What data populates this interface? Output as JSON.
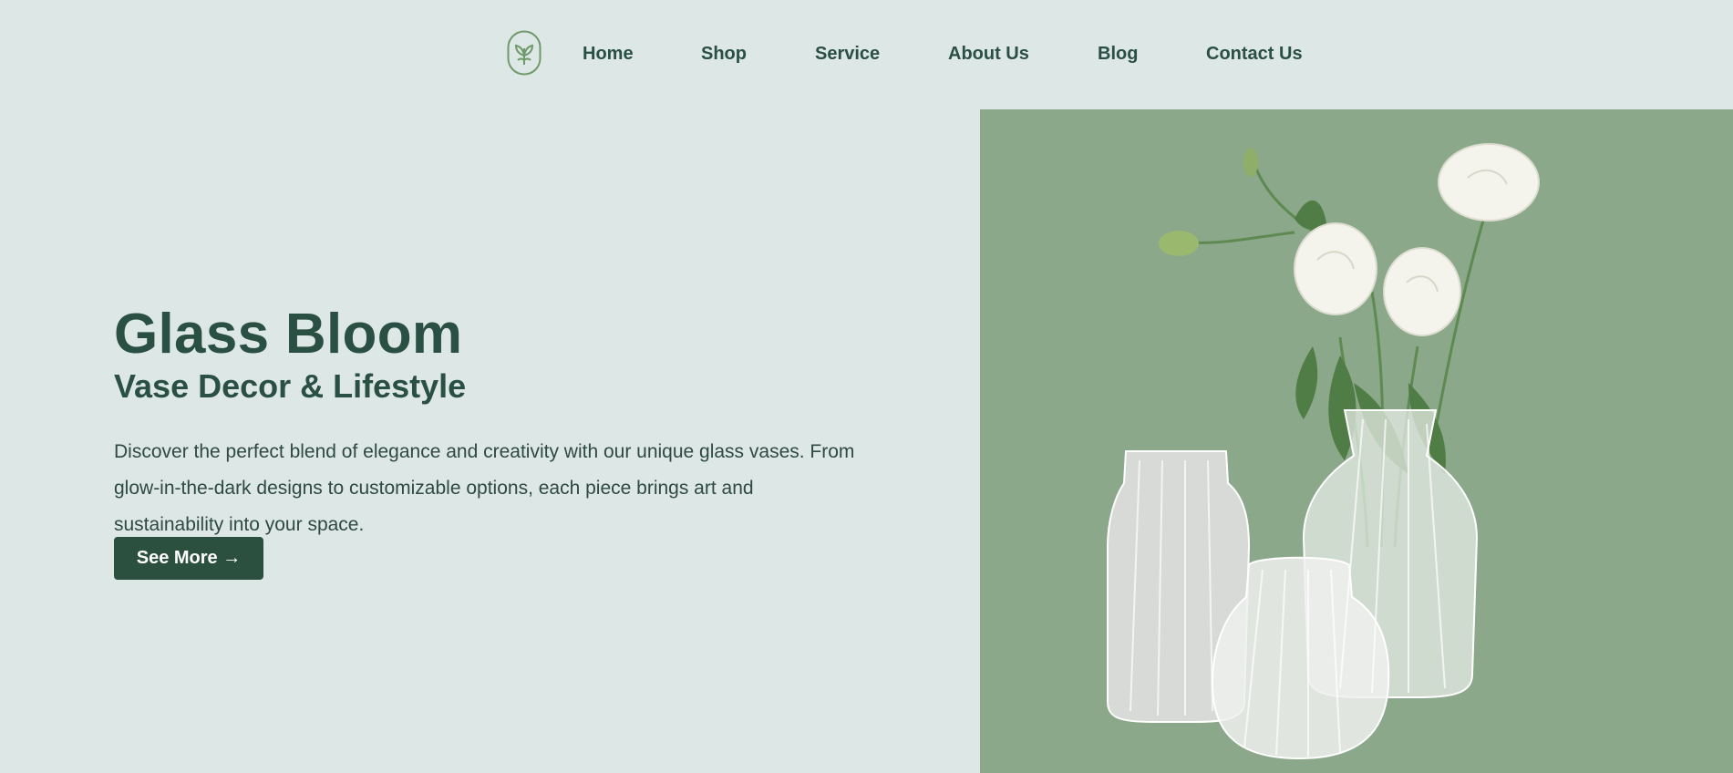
{
  "nav": {
    "logo_icon": "leaf-sprout-icon",
    "links": [
      "Home",
      "Shop",
      "Service",
      "About Us",
      "Blog",
      "Contact Us"
    ]
  },
  "hero": {
    "title": "Glass Bloom",
    "subtitle": "Vase Decor & Lifestyle",
    "description": "Discover the perfect blend of elegance and creativity with our unique glass vases. From glow-in-the-dark designs to customizable options, each piece brings art and sustainability into your space.",
    "button_label": "See More →"
  },
  "colors": {
    "background": "#dde7e5",
    "accent": "#2c5040",
    "photo_background": "#8ba88a"
  }
}
